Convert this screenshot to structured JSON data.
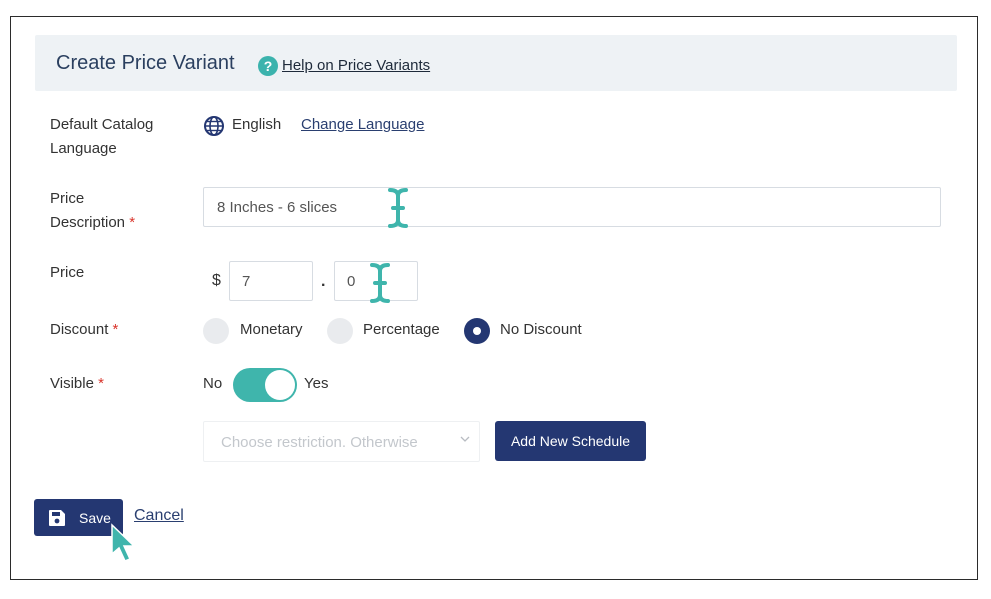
{
  "header": {
    "title": "Create Price Variant",
    "help_icon": "question-circle-icon",
    "help_link": "Help on Price Variants"
  },
  "language": {
    "label_line1": "Default Catalog",
    "label_line2": "Language",
    "icon": "globe-icon",
    "value": "English",
    "change_link": "Change Language"
  },
  "price_description": {
    "label_line1": "Price",
    "label_line2": "Description",
    "required_mark": "*",
    "value": "8 Inches - 6 slices"
  },
  "price": {
    "label": "Price",
    "currency": "$",
    "separator": ".",
    "integer_value": "7",
    "decimal_value": "0"
  },
  "discount": {
    "label": "Discount",
    "required_mark": "*",
    "options": [
      "Monetary",
      "Percentage",
      "No Discount"
    ],
    "selected": "No Discount"
  },
  "visible": {
    "label": "Visible",
    "required_mark": "*",
    "off_label": "No",
    "on_label": "Yes",
    "state": "on"
  },
  "schedule": {
    "restriction_placeholder": "Choose restriction. Otherwise",
    "add_button": "Add New Schedule"
  },
  "actions": {
    "save_label": "Save",
    "save_icon": "floppy-disk-icon",
    "cancel_label": "Cancel"
  },
  "colors": {
    "primary": "#243772",
    "accent": "#3fb5ac",
    "required": "#d9342b",
    "header_bg": "#eef2f5"
  }
}
